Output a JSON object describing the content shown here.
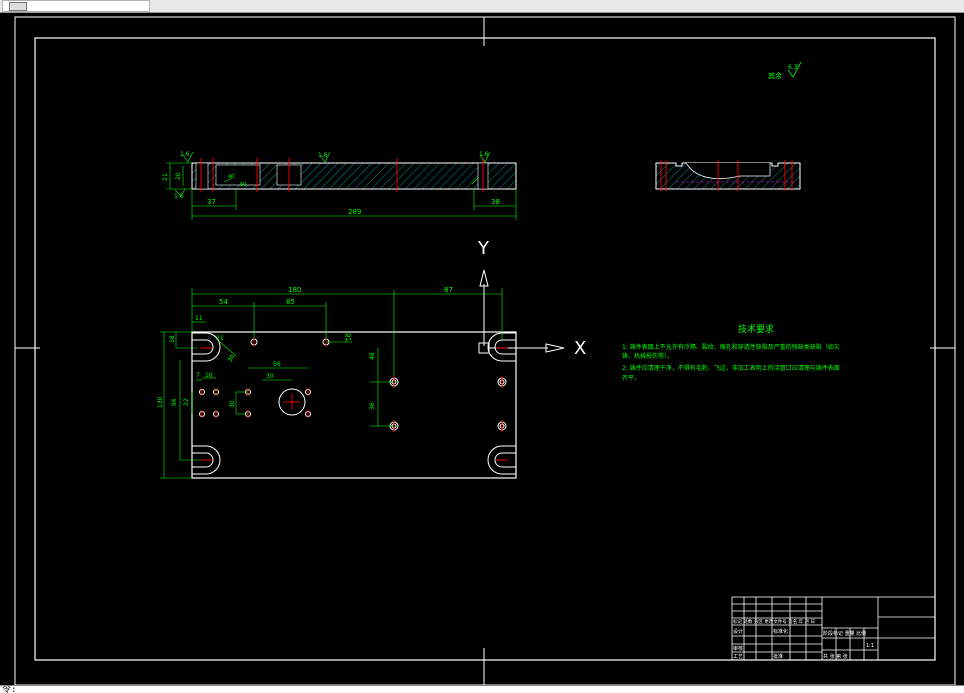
{
  "window": {
    "command_prompt": "令:"
  },
  "surface_note": {
    "label": "其余",
    "value": "6.3"
  },
  "section_view": {
    "dim_37": "37",
    "dim_289": "289",
    "dim_38": "38",
    "dim_21": "21",
    "dim_20": "20",
    "rough_1": "1.6",
    "rough_2": "1.6",
    "rough_3": "1.6",
    "rough_4": "1.6",
    "dim_small_1": "40",
    "dim_small_2": "60"
  },
  "plan_view": {
    "dim_180": "180",
    "dim_87": "87",
    "dim_54": "54",
    "dim_85": "85",
    "dim_10": "10",
    "dim_11": "11",
    "dim_18": "18",
    "dim_21": "21",
    "dim_48": "48",
    "dim_56": "56",
    "dim_30": "30",
    "dim_7": "7",
    "dim_16": "16",
    "dim_22": "22",
    "dim_96": "96",
    "dim_130": "130",
    "dim_30b": "30",
    "dim_36": "36",
    "dim_30c": "30"
  },
  "axes": {
    "y_label": "Y",
    "x_label": "X"
  },
  "tech_requirements": {
    "title": "技术要求",
    "line1": "1: 铸件表面上不允许有冷隔、裂纹、缩孔和穿透性缺陷及严重的残缺类缺陷（如欠",
    "line2": "铸、机械损伤等）。",
    "line3": "2: 铸件应清理干净，不得有毛刺、飞边，非加工表明上的浇冒口应清理与铸件表面",
    "line4": "齐平。"
  },
  "title_block": {
    "row1": "标记 处数 分区 更改文件号 签名 年 月 日",
    "designer": "设计",
    "standardization": "标准化",
    "stage_mark": "阶段标记 重量 比例",
    "scale": "1:1",
    "review": "审核",
    "process": "工艺",
    "approve": "批准",
    "sheets": "共 张 第 张"
  },
  "colors": {
    "outline": "#ffffff",
    "dimension": "#00ff00",
    "hatch": "#00c8c8",
    "centerline": "#ff0000",
    "hidden": "#ff00ff"
  }
}
